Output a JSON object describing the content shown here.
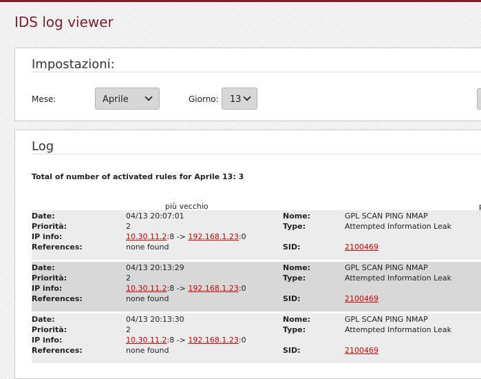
{
  "app": {
    "title": "IDS log viewer"
  },
  "settings": {
    "title": "Impostazioni:",
    "month_label": "Mese:",
    "month_value": "Aprile",
    "day_label": "Giorno:",
    "day_value": "13"
  },
  "log": {
    "title": "Log",
    "total_text": "Total of number of activated rules for Aprile 13: 3",
    "older_label": "più vecchio",
    "newer_label_partial": "p",
    "field_labels": {
      "date": "Date:",
      "priority": "Priorità:",
      "ipinfo": "IP info:",
      "references": "References:",
      "name": "Nome:",
      "type": "Type:",
      "sid": "SID:"
    },
    "entries": [
      {
        "date": "04/13 20:07:01",
        "priority": "2",
        "src_ip": "10.30.11.2",
        "src_port": ":8 -> ",
        "dst_ip": "192.168.1.23",
        "dst_port": ":0",
        "references": "none found",
        "name": "GPL SCAN PING NMAP",
        "type": "Attempted Information Leak",
        "sid": "2100469"
      },
      {
        "date": "04/13 20:13:29",
        "priority": "2",
        "src_ip": "10.30.11.2",
        "src_port": ":8 -> ",
        "dst_ip": "192.168.1.23",
        "dst_port": ":0",
        "references": "none found",
        "name": "GPL SCAN PING NMAP",
        "type": "Attempted Information Leak",
        "sid": "2100469"
      },
      {
        "date": "04/13 20:13:30",
        "priority": "2",
        "src_ip": "10.30.11.2",
        "src_port": ":8 -> ",
        "dst_ip": "192.168.1.23",
        "dst_port": ":0",
        "references": "none found",
        "name": "GPL SCAN PING NMAP",
        "type": "Attempted Information Leak",
        "sid": "2100469"
      }
    ]
  }
}
